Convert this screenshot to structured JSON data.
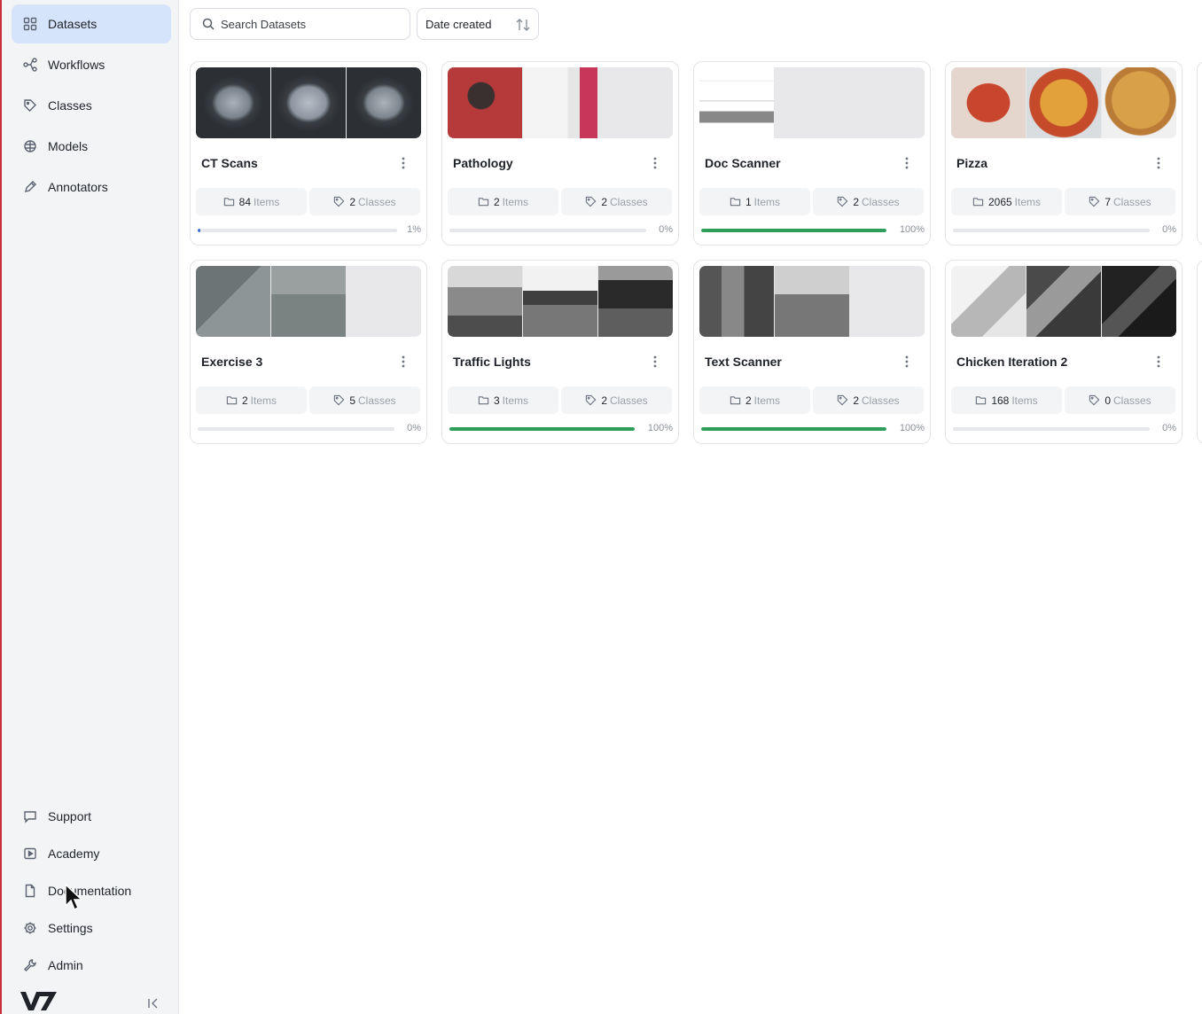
{
  "sidebar": {
    "nav": [
      {
        "label": "Datasets",
        "icon": "grid-icon",
        "active": true
      },
      {
        "label": "Workflows",
        "icon": "workflow-icon"
      },
      {
        "label": "Classes",
        "icon": "tag-icon"
      },
      {
        "label": "Models",
        "icon": "brain-icon"
      },
      {
        "label": "Annotators",
        "icon": "pen-icon"
      }
    ],
    "bottom": [
      {
        "label": "Support",
        "icon": "chat-icon"
      },
      {
        "label": "Academy",
        "icon": "play-icon"
      },
      {
        "label": "Documentation",
        "icon": "document-icon"
      },
      {
        "label": "Settings",
        "icon": "gear-icon"
      },
      {
        "label": "Admin",
        "icon": "wrench-icon"
      }
    ],
    "logo": "V7"
  },
  "toolbar": {
    "search_placeholder": "Search Datasets",
    "sort_label": "Date created"
  },
  "colors": {
    "accent_active": "#d6e4fb",
    "progress_green": "#2e9e5b",
    "progress_blue": "#3b6fd8",
    "progress_track": "#e6e7ea"
  },
  "datasets": [
    {
      "name": "CT Scans",
      "items": "84",
      "items_label": "Items",
      "classes": "2",
      "classes_label": "Classes",
      "progress": 1,
      "progress_text": "1%"
    },
    {
      "name": "Pathology",
      "items": "2",
      "items_label": "Items",
      "classes": "2",
      "classes_label": "Classes",
      "progress": 0,
      "progress_text": "0%"
    },
    {
      "name": "Doc Scanner",
      "items": "1",
      "items_label": "Items",
      "classes": "2",
      "classes_label": "Classes",
      "progress": 100,
      "progress_text": "100%"
    },
    {
      "name": "Pizza",
      "items": "2065",
      "items_label": "Items",
      "classes": "7",
      "classes_label": "Classes",
      "progress": 0,
      "progress_text": "0%"
    },
    {
      "name": "Exercise 3",
      "items": "2",
      "items_label": "Items",
      "classes": "5",
      "classes_label": "Classes",
      "progress": 0,
      "progress_text": "0%"
    },
    {
      "name": "Traffic Lights",
      "items": "3",
      "items_label": "Items",
      "classes": "2",
      "classes_label": "Classes",
      "progress": 100,
      "progress_text": "100%"
    },
    {
      "name": "Text Scanner",
      "items": "2",
      "items_label": "Items",
      "classes": "2",
      "classes_label": "Classes",
      "progress": 100,
      "progress_text": "100%"
    },
    {
      "name": "Chicken Iteration 2",
      "items": "168",
      "items_label": "Items",
      "classes": "0",
      "classes_label": "Classes",
      "progress": 0,
      "progress_text": "0%"
    }
  ]
}
